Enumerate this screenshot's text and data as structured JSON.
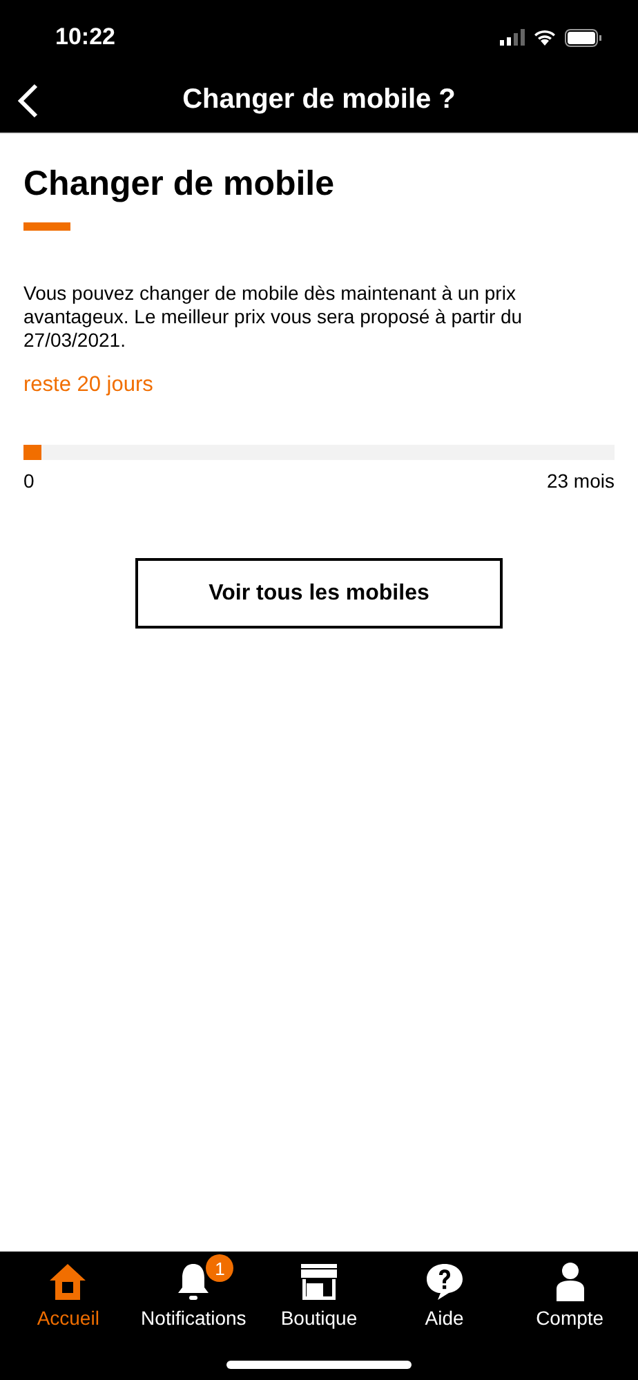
{
  "status_bar": {
    "time": "10:22"
  },
  "header": {
    "title": "Changer de mobile ?"
  },
  "content": {
    "title": "Changer de mobile",
    "description": "Vous pouvez changer de mobile dès maintenant à un prix avantageux. Le meilleur prix  vous sera proposé à partir du 27/03/2021.",
    "remaining": "reste 20 jours",
    "progress": {
      "level": 0.03,
      "start_label": "0",
      "end_label": "23 mois"
    },
    "button": "Voir tous les mobiles"
  },
  "tab_bar": [
    {
      "kind": "home",
      "label": "Accueil",
      "selected": true
    },
    {
      "kind": "bell",
      "label": "Notifications",
      "selected": false,
      "badge": "1"
    },
    {
      "kind": "shop",
      "label": "Boutique",
      "selected": false
    },
    {
      "kind": "help",
      "label": "Aide",
      "selected": false
    },
    {
      "kind": "person",
      "label": "Compte",
      "selected": false
    }
  ]
}
